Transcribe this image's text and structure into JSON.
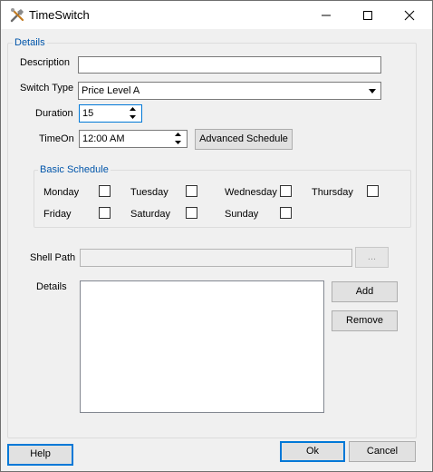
{
  "window": {
    "title": "TimeSwitch",
    "app_icon": "tools-icon",
    "controls": [
      "minimize-icon",
      "maximize-icon",
      "close-icon"
    ]
  },
  "details_group": {
    "legend": "Details",
    "description": {
      "label": "Description",
      "value": ""
    },
    "switch_type": {
      "label": "Switch Type",
      "selected": "Price Level A"
    },
    "duration": {
      "label": "Duration",
      "value": "15"
    },
    "time_on": {
      "label": "TimeOn",
      "value": "12:00 AM"
    },
    "advanced_schedule_label": "Advanced Schedule",
    "basic_schedule": {
      "legend": "Basic Schedule",
      "days": [
        {
          "label": "Monday",
          "checked": false
        },
        {
          "label": "Tuesday",
          "checked": false
        },
        {
          "label": "Wednesday",
          "checked": false
        },
        {
          "label": "Thursday",
          "checked": false
        },
        {
          "label": "Friday",
          "checked": false
        },
        {
          "label": "Saturday",
          "checked": false
        },
        {
          "label": "Sunday",
          "checked": false
        }
      ]
    },
    "shell_path": {
      "label": "Shell Path",
      "value": "",
      "browse_label": "..."
    },
    "details_list": {
      "label": "Details",
      "items": []
    },
    "add_label": "Add",
    "remove_label": "Remove"
  },
  "footer": {
    "help_label": "Help",
    "ok_label": "Ok",
    "cancel_label": "Cancel"
  }
}
